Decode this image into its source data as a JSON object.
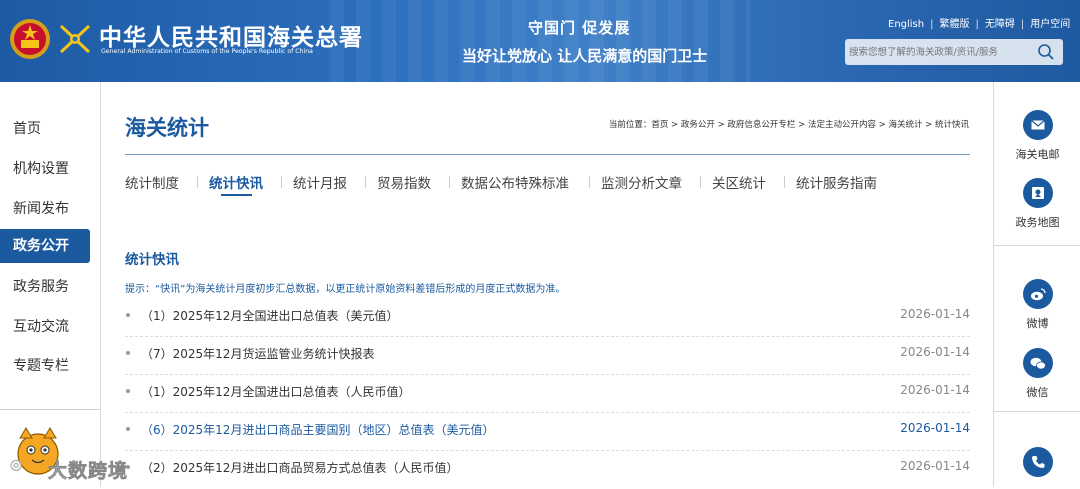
{
  "header": {
    "site_title": "中华人民共和国海关总署",
    "site_subtitle": "General Administration of Customs of the People's Republic of China",
    "slogan_line1": "守国门    促发展",
    "slogan_line2": "当好让党放心    让人民满意的国门卫士",
    "links": [
      "English",
      "繁體版",
      "无障碍",
      "用户空间"
    ],
    "search_placeholder": "搜索您想了解的海关政策/资讯/服务"
  },
  "leftnav": {
    "items": [
      {
        "label": "首页",
        "active": false
      },
      {
        "label": "机构设置",
        "active": false
      },
      {
        "label": "新闻发布",
        "active": false
      },
      {
        "label": "政务公开",
        "active": true
      },
      {
        "label": "政务服务",
        "active": false
      },
      {
        "label": "互动交流",
        "active": false
      },
      {
        "label": "专题专栏",
        "active": false
      }
    ]
  },
  "rightbar": {
    "items": [
      {
        "label": "海关电邮",
        "icon": "mail-icon"
      },
      {
        "label": "政务地图",
        "icon": "map-icon"
      },
      {
        "label": "微博",
        "icon": "weibo-icon"
      },
      {
        "label": "微信",
        "icon": "wechat-icon"
      },
      {
        "label": "",
        "icon": "phone-icon"
      }
    ]
  },
  "main": {
    "page_title": "海关统计",
    "breadcrumb": "当前位置：首页 > 政务公开 > 政府信息公开专栏 > 法定主动公开内容 > 海关统计 > 统计快讯",
    "tabs": [
      {
        "label": "统计制度",
        "active": false
      },
      {
        "label": "统计快讯",
        "active": true
      },
      {
        "label": "统计月报",
        "active": false
      },
      {
        "label": "贸易指数",
        "active": false
      },
      {
        "label": "数据公布特殊标准",
        "active": false
      },
      {
        "label": "监测分析文章",
        "active": false
      },
      {
        "label": "关区统计",
        "active": false
      },
      {
        "label": "统计服务指南",
        "active": false
      }
    ],
    "section_title": "统计快讯",
    "tip": "提示：“快讯”为海关统计月度初步汇总数据，以更正统计原始资料差错后形成的月度正式数据为准。",
    "list": [
      {
        "title": "（1）2025年12月全国进出口总值表（美元值）",
        "date": "2026-01-14",
        "highlight": false
      },
      {
        "title": "（7）2025年12月货运监管业务统计快报表",
        "date": "2026-01-14",
        "highlight": false
      },
      {
        "title": "（1）2025年12月全国进出口总值表（人民币值）",
        "date": "2026-01-14",
        "highlight": false
      },
      {
        "title": "（6）2025年12月进出口商品主要国别（地区）总值表（美元值）",
        "date": "2026-01-14",
        "highlight": true
      },
      {
        "title": "（2）2025年12月进出口商品贸易方式总值表（人民币值）",
        "date": "2026-01-14",
        "highlight": false
      }
    ]
  },
  "watermark": {
    "text": "大数跨境"
  },
  "colors": {
    "primary": "#1c5aa0",
    "header_bg": "#2c6fbd"
  }
}
